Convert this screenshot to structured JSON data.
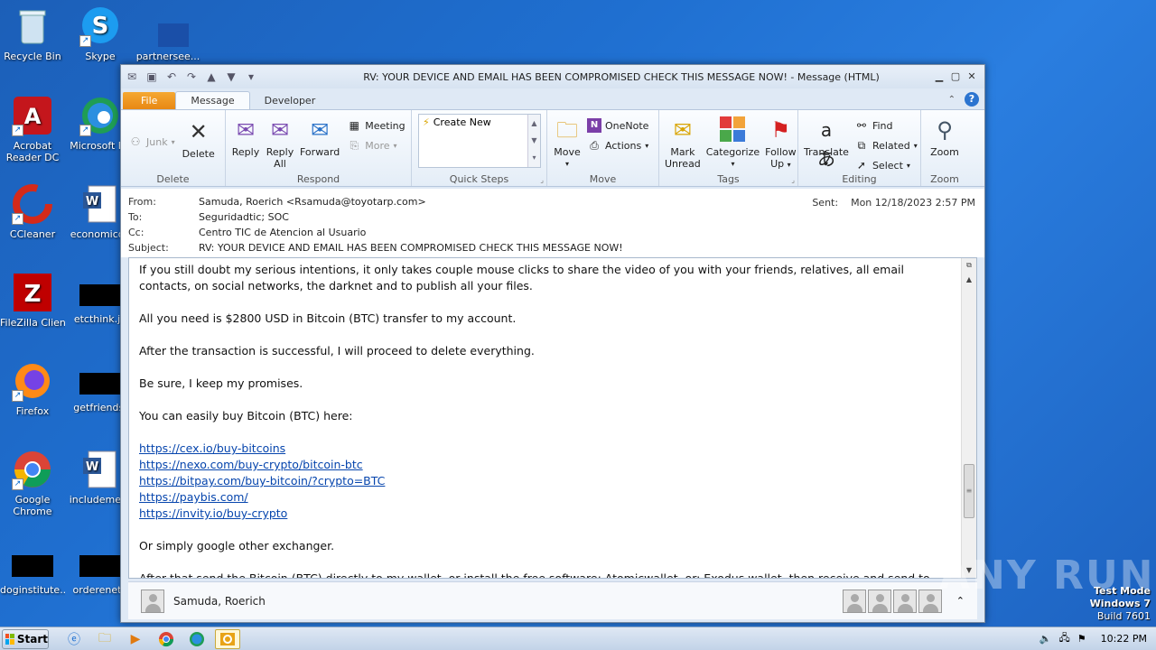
{
  "desktop": {
    "icons": [
      {
        "label": "Recycle Bin",
        "icon": "recycle-bin-icon"
      },
      {
        "label": "Skype",
        "icon": "skype-icon"
      },
      {
        "label": "partnersee...",
        "icon": "blank-file-icon"
      },
      {
        "label": "Acrobat Reader DC",
        "icon": "acrobat-icon"
      },
      {
        "label": "Microsoft Ed",
        "icon": "edge-icon"
      },
      {
        "label": "CCleaner",
        "icon": "ccleaner-icon"
      },
      {
        "label": "economicdv",
        "icon": "word-doc-icon"
      },
      {
        "label": "FileZilla Client",
        "icon": "filezilla-icon"
      },
      {
        "label": "etcthink.jp",
        "icon": "black-image-icon"
      },
      {
        "label": "Firefox",
        "icon": "firefox-icon"
      },
      {
        "label": "getfriends.",
        "icon": "black-image-icon"
      },
      {
        "label": "Google Chrome",
        "icon": "chrome-icon"
      },
      {
        "label": "includemeth",
        "icon": "word-doc-icon"
      },
      {
        "label": "doginstitute....",
        "icon": "black-image-icon"
      },
      {
        "label": "orderenetg",
        "icon": "black-image-icon"
      }
    ]
  },
  "window": {
    "title": "RV: YOUR DEVICE AND EMAIL HAS BEEN COMPROMISED CHECK THIS MESSAGE NOW!  -  Message (HTML)",
    "tabs": [
      "File",
      "Message",
      "Developer"
    ],
    "active_tab": "Message"
  },
  "ribbon": {
    "delete": {
      "junk": "Junk",
      "delete": "Delete",
      "group": "Delete"
    },
    "respond": {
      "reply": "Reply",
      "reply_all_1": "Reply",
      "reply_all_2": "All",
      "forward": "Forward",
      "meeting": "Meeting",
      "more": "More",
      "group": "Respond"
    },
    "quick_steps": {
      "create_new": "Create New",
      "group": "Quick Steps"
    },
    "move": {
      "move": "Move",
      "onenote": "OneNote",
      "actions": "Actions",
      "group": "Move"
    },
    "tags": {
      "mark_1": "Mark",
      "mark_2": "Unread",
      "categorize": "Categorize",
      "follow_1": "Follow",
      "follow_2": "Up",
      "group": "Tags"
    },
    "editing": {
      "translate": "Translate",
      "find": "Find",
      "related": "Related",
      "select": "Select",
      "group": "Editing"
    },
    "zoom": {
      "zoom": "Zoom",
      "group": "Zoom"
    }
  },
  "header": {
    "from_label": "From:",
    "from": "Samuda, Roerich <Rsamuda@toyotarp.com>",
    "to_label": "To:",
    "to": "Seguridadtic; SOC",
    "cc_label": "Cc:",
    "cc": "Centro TIC de Atencion al Usuario",
    "subject_label": "Subject:",
    "subject": "RV: YOUR DEVICE AND EMAIL HAS BEEN COMPROMISED CHECK THIS MESSAGE NOW!",
    "sent_label": "Sent:",
    "sent": "Mon 12/18/2023 2:57 PM"
  },
  "body": {
    "p1": "If you still doubt my serious intentions, it only takes couple mouse clicks to share the video of you with your friends, relatives, all email contacts, on social networks, the darknet and to publish all your files.",
    "p2": "All you need is $2800 USD in Bitcoin (BTC) transfer to my account.",
    "p3": "After the transaction is successful, I will proceed to delete everything.",
    "p4": "Be sure, I keep my promises.",
    "p5": "You can easily buy Bitcoin (BTC) here:",
    "links": [
      "https://cex.io/buy-bitcoins",
      "https://nexo.com/buy-crypto/bitcoin-btc",
      "https://bitpay.com/buy-bitcoin/?crypto=BTC",
      "https://paybis.com/",
      "https://invity.io/buy-crypto"
    ],
    "p6": "Or simply google other exchanger.",
    "p7": "After that send the Bitcoin (BTC) directly to my wallet, or install the free software: Atomicwallet, or: Exodus wallet, then receive and send to"
  },
  "people_pane": {
    "name": "Samuda, Roerich"
  },
  "taskbar": {
    "start": "Start",
    "time": "10:22 PM"
  },
  "watermark": "ANY RUN",
  "os_info": {
    "line1": "Test Mode",
    "line2": "Windows 7",
    "line3": "Build 7601"
  }
}
